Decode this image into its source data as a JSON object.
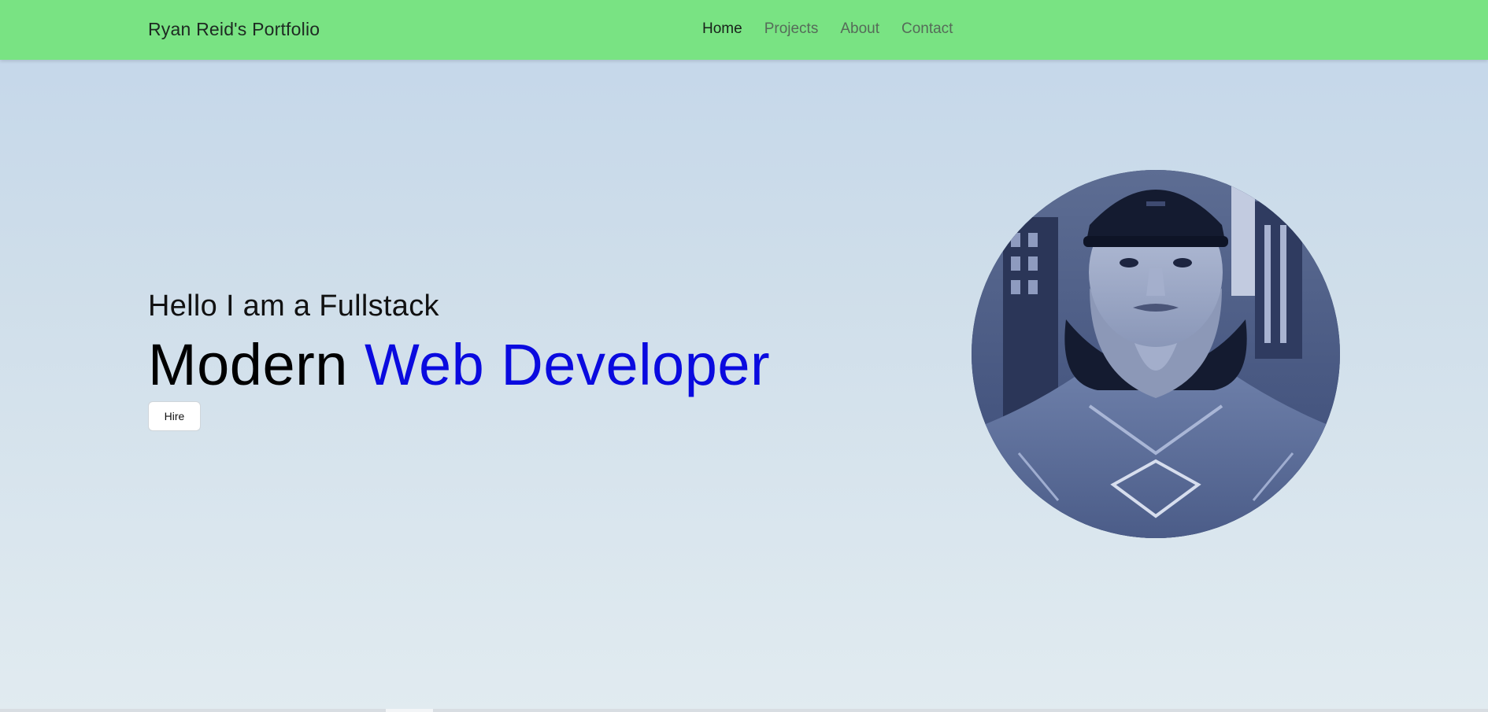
{
  "navbar": {
    "brand": "Ryan Reid's Portfolio",
    "links": [
      {
        "label": "Home",
        "active": true
      },
      {
        "label": "Projects",
        "active": false
      },
      {
        "label": "About",
        "active": false
      },
      {
        "label": "Contact",
        "active": false
      }
    ],
    "background_color": "#79e383"
  },
  "hero": {
    "intro": "Hello I am a Fullstack",
    "headline_plain": "Modern ",
    "headline_accent": "Web Developer",
    "accent_color": "#0a0adf",
    "hire_button_label": "Hire"
  },
  "avatar": {
    "icon": "profile-photo"
  }
}
